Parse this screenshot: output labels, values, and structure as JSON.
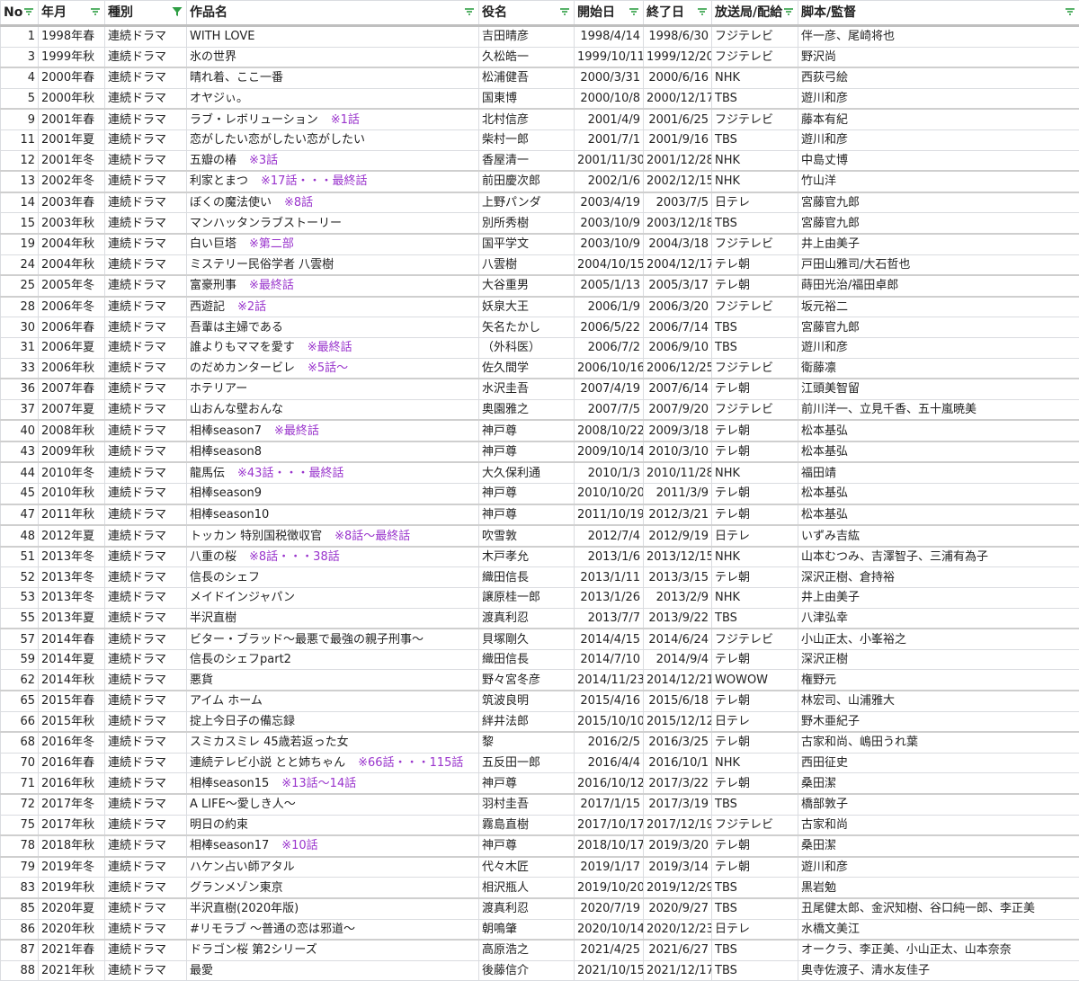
{
  "columns": [
    {
      "label": "No",
      "filter": "sort-lines"
    },
    {
      "label": "年月",
      "filter": "sort-lines"
    },
    {
      "label": "種別",
      "filter": "funnel-filter-active"
    },
    {
      "label": "作品名",
      "filter": "sort-lines"
    },
    {
      "label": "役名",
      "filter": "sort-lines"
    },
    {
      "label": "開始日",
      "filter": "sort-lines"
    },
    {
      "label": "終了日",
      "filter": "sort-lines"
    },
    {
      "label": "放送局/配給",
      "filter": "sort-lines"
    },
    {
      "label": "脚本/監督",
      "filter": "sort-lines"
    }
  ],
  "colors": {
    "accent": "#2e9e44",
    "note": "#9933cc",
    "grid": "#dadce0"
  },
  "rows": [
    {
      "no": "1",
      "ym": "1998年春",
      "type": "連続ドラマ",
      "title": "WITH LOVE",
      "note": "",
      "role": "吉田晴彦",
      "start": "1998/4/14",
      "end": "1998/6/30",
      "station": "フジテレビ",
      "writer": "伴一彦、尾崎将也",
      "grp": true
    },
    {
      "no": "3",
      "ym": "1999年秋",
      "type": "連続ドラマ",
      "title": "氷の世界",
      "note": "",
      "role": "久松皓一",
      "start": "1999/10/11",
      "end": "1999/12/20",
      "station": "フジテレビ",
      "writer": "野沢尚",
      "grp": false
    },
    {
      "no": "4",
      "ym": "2000年春",
      "type": "連続ドラマ",
      "title": "晴れ着、ここ一番",
      "note": "",
      "role": "松浦健吾",
      "start": "2000/3/31",
      "end": "2000/6/16",
      "station": "NHK",
      "writer": "西荻弓絵",
      "grp": true
    },
    {
      "no": "5",
      "ym": "2000年秋",
      "type": "連続ドラマ",
      "title": "オヤジぃ。",
      "note": "",
      "role": "国東博",
      "start": "2000/10/8",
      "end": "2000/12/17",
      "station": "TBS",
      "writer": "遊川和彦",
      "grp": false
    },
    {
      "no": "9",
      "ym": "2001年春",
      "type": "連続ドラマ",
      "title": "ラブ・レボリューション",
      "note": "※1話",
      "role": "北村信彦",
      "start": "2001/4/9",
      "end": "2001/6/25",
      "station": "フジテレビ",
      "writer": "藤本有紀",
      "grp": true
    },
    {
      "no": "11",
      "ym": "2001年夏",
      "type": "連続ドラマ",
      "title": "恋がしたい恋がしたい恋がしたい",
      "note": "",
      "role": "柴村一郎",
      "start": "2001/7/1",
      "end": "2001/9/16",
      "station": "TBS",
      "writer": "遊川和彦",
      "grp": false
    },
    {
      "no": "12",
      "ym": "2001年冬",
      "type": "連続ドラマ",
      "title": "五瓣の椿",
      "note": "※3話",
      "role": "香屋清一",
      "start": "2001/11/30",
      "end": "2001/12/28",
      "station": "NHK",
      "writer": "中島丈博",
      "grp": false
    },
    {
      "no": "13",
      "ym": "2002年冬",
      "type": "連続ドラマ",
      "title": "利家とまつ",
      "note": "※17話・・・最終話",
      "role": "前田慶次郎",
      "start": "2002/1/6",
      "end": "2002/12/15",
      "station": "NHK",
      "writer": "竹山洋",
      "grp": true
    },
    {
      "no": "14",
      "ym": "2003年春",
      "type": "連続ドラマ",
      "title": "ぼくの魔法使い",
      "note": "※8話",
      "role": "上野パンダ",
      "start": "2003/4/19",
      "end": "2003/7/5",
      "station": "日テレ",
      "writer": "宮藤官九郎",
      "grp": true
    },
    {
      "no": "15",
      "ym": "2003年秋",
      "type": "連続ドラマ",
      "title": "マンハッタンラブストーリー",
      "note": "",
      "role": "別所秀樹",
      "start": "2003/10/9",
      "end": "2003/12/18",
      "station": "TBS",
      "writer": "宮藤官九郎",
      "grp": false
    },
    {
      "no": "19",
      "ym": "2004年秋",
      "type": "連続ドラマ",
      "title": "白い巨塔",
      "note": "※第二部",
      "role": "国平学文",
      "start": "2003/10/9",
      "end": "2004/3/18",
      "station": "フジテレビ",
      "writer": "井上由美子",
      "grp": true
    },
    {
      "no": "24",
      "ym": "2004年秋",
      "type": "連続ドラマ",
      "title": "ミステリー民俗学者 八雲樹",
      "note": "",
      "role": "八雲樹",
      "start": "2004/10/15",
      "end": "2004/12/17",
      "station": "テレ朝",
      "writer": "戸田山雅司/大石哲也",
      "grp": false
    },
    {
      "no": "25",
      "ym": "2005年冬",
      "type": "連続ドラマ",
      "title": "富豪刑事",
      "note": "※最終話",
      "role": "大谷重男",
      "start": "2005/1/13",
      "end": "2005/3/17",
      "station": "テレ朝",
      "writer": "蒔田光治/福田卓郎",
      "grp": true
    },
    {
      "no": "28",
      "ym": "2006年冬",
      "type": "連続ドラマ",
      "title": "西遊記",
      "note": "※2話",
      "role": "妖泉大王",
      "start": "2006/1/9",
      "end": "2006/3/20",
      "station": "フジテレビ",
      "writer": "坂元裕二",
      "grp": true
    },
    {
      "no": "30",
      "ym": "2006年春",
      "type": "連続ドラマ",
      "title": "吾輩は主婦である",
      "note": "",
      "role": "矢名たかし",
      "start": "2006/5/22",
      "end": "2006/7/14",
      "station": "TBS",
      "writer": "宮藤官九郎",
      "grp": false
    },
    {
      "no": "31",
      "ym": "2006年夏",
      "type": "連続ドラマ",
      "title": "誰よりもママを愛す",
      "note": "※最終話",
      "role": "（外科医）",
      "start": "2006/7/2",
      "end": "2006/9/10",
      "station": "TBS",
      "writer": "遊川和彦",
      "grp": false
    },
    {
      "no": "33",
      "ym": "2006年秋",
      "type": "連続ドラマ",
      "title": "のだめカンタービレ",
      "note": "※5話～",
      "role": "佐久間学",
      "start": "2006/10/16",
      "end": "2006/12/25",
      "station": "フジテレビ",
      "writer": "衛藤凛",
      "grp": false
    },
    {
      "no": "36",
      "ym": "2007年春",
      "type": "連続ドラマ",
      "title": "ホテリアー",
      "note": "",
      "role": "水沢圭吾",
      "start": "2007/4/19",
      "end": "2007/6/14",
      "station": "テレ朝",
      "writer": "江頭美智留",
      "grp": true
    },
    {
      "no": "37",
      "ym": "2007年夏",
      "type": "連続ドラマ",
      "title": "山おんな壁おんな",
      "note": "",
      "role": "奥園雅之",
      "start": "2007/7/5",
      "end": "2007/9/20",
      "station": "フジテレビ",
      "writer": "前川洋一、立見千香、五十嵐暁美",
      "grp": false
    },
    {
      "no": "40",
      "ym": "2008年秋",
      "type": "連続ドラマ",
      "title": "相棒season7",
      "note": "※最終話",
      "role": "神戸尊",
      "start": "2008/10/22",
      "end": "2009/3/18",
      "station": "テレ朝",
      "writer": "松本基弘",
      "grp": true
    },
    {
      "no": "43",
      "ym": "2009年秋",
      "type": "連続ドラマ",
      "title": "相棒season8",
      "note": "",
      "role": "神戸尊",
      "start": "2009/10/14",
      "end": "2010/3/10",
      "station": "テレ朝",
      "writer": "松本基弘",
      "grp": true
    },
    {
      "no": "44",
      "ym": "2010年冬",
      "type": "連続ドラマ",
      "title": "龍馬伝",
      "note": "※43話・・・最終話",
      "role": "大久保利通",
      "start": "2010/1/3",
      "end": "2010/11/28",
      "station": "NHK",
      "writer": "福田靖",
      "grp": true
    },
    {
      "no": "45",
      "ym": "2010年秋",
      "type": "連続ドラマ",
      "title": "相棒season9",
      "note": "",
      "role": "神戸尊",
      "start": "2010/10/20",
      "end": "2011/3/9",
      "station": "テレ朝",
      "writer": "松本基弘",
      "grp": false
    },
    {
      "no": "47",
      "ym": "2011年秋",
      "type": "連続ドラマ",
      "title": "相棒season10",
      "note": "",
      "role": "神戸尊",
      "start": "2011/10/19",
      "end": "2012/3/21",
      "station": "テレ朝",
      "writer": "松本基弘",
      "grp": true
    },
    {
      "no": "48",
      "ym": "2012年夏",
      "type": "連続ドラマ",
      "title": "トッカン 特別国税徴収官",
      "note": "※8話～最終話",
      "role": "吹雪敦",
      "start": "2012/7/4",
      "end": "2012/9/19",
      "station": "日テレ",
      "writer": "いずみ吉紘",
      "grp": true
    },
    {
      "no": "51",
      "ym": "2013年冬",
      "type": "連続ドラマ",
      "title": "八重の桜",
      "note": "※8話・・・38話",
      "role": "木戸孝允",
      "start": "2013/1/6",
      "end": "2013/12/15",
      "station": "NHK",
      "writer": "山本むつみ、吉澤智子、三浦有為子",
      "grp": true
    },
    {
      "no": "52",
      "ym": "2013年冬",
      "type": "連続ドラマ",
      "title": "信長のシェフ",
      "note": "",
      "role": "織田信長",
      "start": "2013/1/11",
      "end": "2013/3/15",
      "station": "テレ朝",
      "writer": "深沢正樹、倉持裕",
      "grp": false
    },
    {
      "no": "53",
      "ym": "2013年冬",
      "type": "連続ドラマ",
      "title": "メイドインジャパン",
      "note": "",
      "role": "譲原桂一郎",
      "start": "2013/1/26",
      "end": "2013/2/9",
      "station": "NHK",
      "writer": "井上由美子",
      "grp": false
    },
    {
      "no": "55",
      "ym": "2013年夏",
      "type": "連続ドラマ",
      "title": "半沢直樹",
      "note": "",
      "role": "渡真利忍",
      "start": "2013/7/7",
      "end": "2013/9/22",
      "station": "TBS",
      "writer": "八津弘幸",
      "grp": false
    },
    {
      "no": "57",
      "ym": "2014年春",
      "type": "連続ドラマ",
      "title": "ビター・ブラッド～最悪で最強の親子刑事～",
      "note": "",
      "role": "貝塚剛久",
      "start": "2014/4/15",
      "end": "2014/6/24",
      "station": "フジテレビ",
      "writer": "小山正太、小峯裕之",
      "grp": true
    },
    {
      "no": "59",
      "ym": "2014年夏",
      "type": "連続ドラマ",
      "title": "信長のシェフpart2",
      "note": "",
      "role": "織田信長",
      "start": "2014/7/10",
      "end": "2014/9/4",
      "station": "テレ朝",
      "writer": "深沢正樹",
      "grp": false
    },
    {
      "no": "62",
      "ym": "2014年秋",
      "type": "連続ドラマ",
      "title": "悪貨",
      "note": "",
      "role": "野々宮冬彦",
      "start": "2014/11/23",
      "end": "2014/12/21",
      "station": "WOWOW",
      "writer": "権野元",
      "grp": false
    },
    {
      "no": "65",
      "ym": "2015年春",
      "type": "連続ドラマ",
      "title": "アイム ホーム",
      "note": "",
      "role": "筑波良明",
      "start": "2015/4/16",
      "end": "2015/6/18",
      "station": "テレ朝",
      "writer": "林宏司、山浦雅大",
      "grp": true
    },
    {
      "no": "66",
      "ym": "2015年秋",
      "type": "連続ドラマ",
      "title": "掟上今日子の備忘録",
      "note": "",
      "role": "絆井法郎",
      "start": "2015/10/10",
      "end": "2015/12/12",
      "station": "日テレ",
      "writer": "野木亜紀子",
      "grp": false
    },
    {
      "no": "68",
      "ym": "2016年冬",
      "type": "連続ドラマ",
      "title": "スミカスミレ 45歳若返った女",
      "note": "",
      "role": "黎",
      "start": "2016/2/5",
      "end": "2016/3/25",
      "station": "テレ朝",
      "writer": "古家和尚、嶋田うれ葉",
      "grp": true
    },
    {
      "no": "70",
      "ym": "2016年春",
      "type": "連続ドラマ",
      "title": "連続テレビ小説 とと姉ちゃん",
      "note": "※66話・・・115話",
      "role": "五反田一郎",
      "start": "2016/4/4",
      "end": "2016/10/1",
      "station": "NHK",
      "writer": "西田征史",
      "grp": false
    },
    {
      "no": "71",
      "ym": "2016年秋",
      "type": "連続ドラマ",
      "title": "相棒season15",
      "note": "※13話～14話",
      "role": "神戸尊",
      "start": "2016/10/12",
      "end": "2017/3/22",
      "station": "テレ朝",
      "writer": "桑田潔",
      "grp": false
    },
    {
      "no": "72",
      "ym": "2017年冬",
      "type": "連続ドラマ",
      "title": "A LIFE～愛しき人～",
      "note": "",
      "role": "羽村圭吾",
      "start": "2017/1/15",
      "end": "2017/3/19",
      "station": "TBS",
      "writer": "橋部敦子",
      "grp": true
    },
    {
      "no": "75",
      "ym": "2017年秋",
      "type": "連続ドラマ",
      "title": "明日の約束",
      "note": "",
      "role": "霧島直樹",
      "start": "2017/10/17",
      "end": "2017/12/19",
      "station": "フジテレビ",
      "writer": "古家和尚",
      "grp": false
    },
    {
      "no": "78",
      "ym": "2018年秋",
      "type": "連続ドラマ",
      "title": "相棒season17",
      "note": "※10話",
      "role": "神戸尊",
      "start": "2018/10/17",
      "end": "2019/3/20",
      "station": "テレ朝",
      "writer": "桑田潔",
      "grp": true
    },
    {
      "no": "79",
      "ym": "2019年冬",
      "type": "連続ドラマ",
      "title": "ハケン占い師アタル",
      "note": "",
      "role": "代々木匠",
      "start": "2019/1/17",
      "end": "2019/3/14",
      "station": "テレ朝",
      "writer": "遊川和彦",
      "grp": true
    },
    {
      "no": "83",
      "ym": "2019年秋",
      "type": "連続ドラマ",
      "title": "グランメゾン東京",
      "note": "",
      "role": "相沢瓶人",
      "start": "2019/10/20",
      "end": "2019/12/29",
      "station": "TBS",
      "writer": "黒岩勉",
      "grp": false
    },
    {
      "no": "85",
      "ym": "2020年夏",
      "type": "連続ドラマ",
      "title": "半沢直樹(2020年版)",
      "note": "",
      "role": "渡真利忍",
      "start": "2020/7/19",
      "end": "2020/9/27",
      "station": "TBS",
      "writer": "丑尾健太郎、金沢知樹、谷口純一郎、李正美",
      "grp": true
    },
    {
      "no": "86",
      "ym": "2020年秋",
      "type": "連続ドラマ",
      "title": "#リモラブ ～普通の恋は邪道～",
      "note": "",
      "role": "朝鳴肇",
      "start": "2020/10/14",
      "end": "2020/12/23",
      "station": "日テレ",
      "writer": "水橋文美江",
      "grp": false
    },
    {
      "no": "87",
      "ym": "2021年春",
      "type": "連続ドラマ",
      "title": "ドラゴン桜 第2シリーズ",
      "note": "",
      "role": "高原浩之",
      "start": "2021/4/25",
      "end": "2021/6/27",
      "station": "TBS",
      "writer": "オークラ、李正美、小山正太、山本奈奈",
      "grp": true
    },
    {
      "no": "88",
      "ym": "2021年秋",
      "type": "連続ドラマ",
      "title": "最愛",
      "note": "",
      "role": "後藤信介",
      "start": "2021/10/15",
      "end": "2021/12/17",
      "station": "TBS",
      "writer": "奥寺佐渡子、清水友佳子",
      "grp": false
    }
  ]
}
